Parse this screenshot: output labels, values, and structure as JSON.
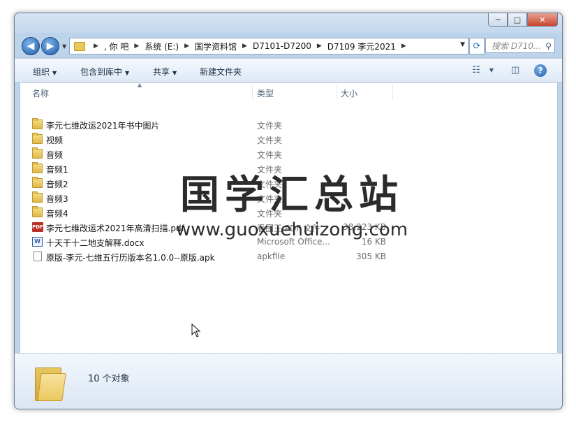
{
  "window": {
    "controls": {
      "minimize": "─",
      "maximize": "□",
      "close": "✕"
    }
  },
  "address": {
    "breadcrumbs": [
      ", 你  吧",
      "系统 (E:)",
      "国学资料馆",
      "D7101-D7200",
      "D7109 李元2021"
    ],
    "search_placeholder": "搜索 D710..."
  },
  "toolbar": {
    "organize": "组织",
    "include_in_library": "包含到库中",
    "share": "共享",
    "new_folder": "新建文件夹"
  },
  "columns": {
    "name": "名称",
    "type": "类型",
    "size": "大小"
  },
  "files": [
    {
      "icon": "folder",
      "name": "李元七维改运2021年书中图片",
      "type": "文件夹",
      "size": ""
    },
    {
      "icon": "folder",
      "name": "视频",
      "type": "文件夹",
      "size": ""
    },
    {
      "icon": "folder",
      "name": "音频",
      "type": "文件夹",
      "size": ""
    },
    {
      "icon": "folder",
      "name": "音频1",
      "type": "文件夹",
      "size": ""
    },
    {
      "icon": "folder",
      "name": "音频2",
      "type": "文件夹",
      "size": ""
    },
    {
      "icon": "folder",
      "name": "音频3",
      "type": "文件夹",
      "size": ""
    },
    {
      "icon": "folder",
      "name": "音频4",
      "type": "文件夹",
      "size": ""
    },
    {
      "icon": "pdf",
      "name": "李元七维改运术2021年高清扫描.pdf",
      "type": "看图王 PDF 文件",
      "size": "38,223 KB"
    },
    {
      "icon": "doc",
      "name": "十天干十二地支解释.docx",
      "type": "Microsoft Office...",
      "size": "16 KB"
    },
    {
      "icon": "blank",
      "name": "原版-李元-七维五行历版本名1.0.0--原版.apk",
      "type": "apkfile",
      "size": "305 KB"
    }
  ],
  "watermark": {
    "text_cn": "国学汇总站",
    "url": "www.guoxuehuizong.com"
  },
  "status": {
    "item_count": "10 个对象"
  },
  "colors": {
    "accent": "#1f5ea8",
    "folder": "#e9c95a",
    "pdf": "#b7312a"
  }
}
